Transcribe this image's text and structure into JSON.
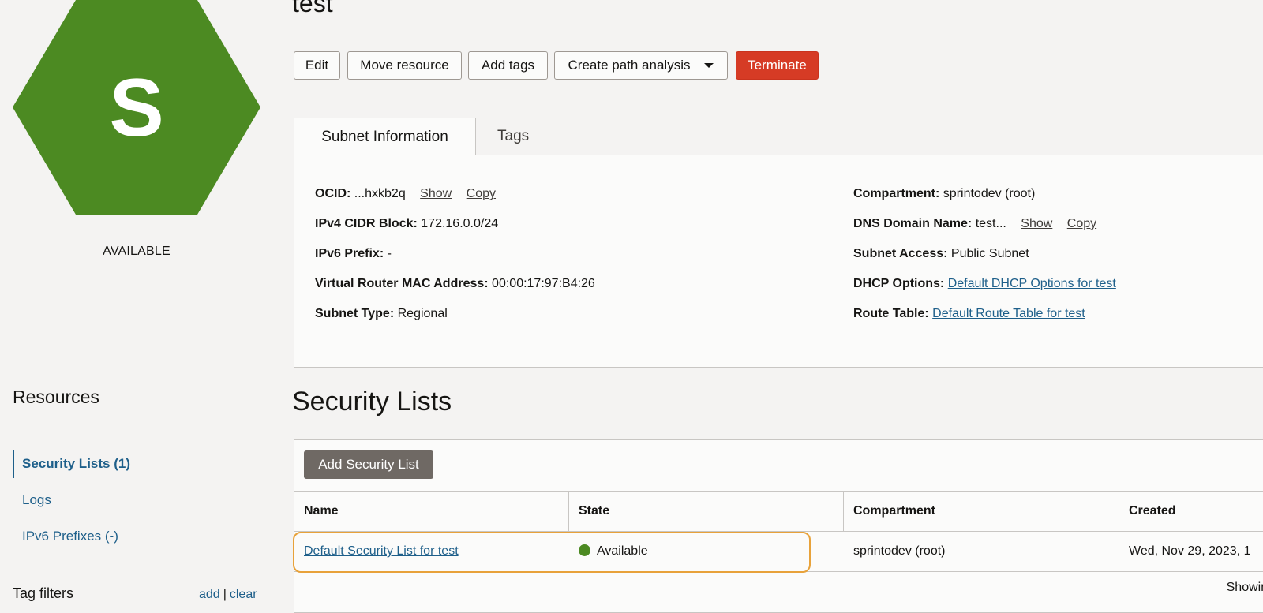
{
  "resource": {
    "icon_letter": "S",
    "state": "AVAILABLE",
    "title": "test",
    "brand_color": "#4c8a22"
  },
  "actions": {
    "edit": "Edit",
    "move": "Move resource",
    "add_tags": "Add tags",
    "path_analysis": "Create path analysis",
    "terminate": "Terminate"
  },
  "tabs": {
    "info": "Subnet Information",
    "tags": "Tags"
  },
  "info": {
    "ocid_label": "OCID:",
    "ocid_value": "...hxkb2q",
    "show": "Show",
    "copy": "Copy",
    "ipv4_label": "IPv4 CIDR Block:",
    "ipv4_value": "172.16.0.0/24",
    "ipv6_label": "IPv6 Prefix:",
    "ipv6_value": "-",
    "mac_label": "Virtual Router MAC Address:",
    "mac_value": "00:00:17:97:B4:26",
    "type_label": "Subnet Type:",
    "type_value": "Regional",
    "compartment_label": "Compartment:",
    "compartment_value": "sprintodev (root)",
    "dns_label": "DNS Domain Name:",
    "dns_value": "test...",
    "access_label": "Subnet Access:",
    "access_value": "Public Subnet",
    "dhcp_label": "DHCP Options:",
    "dhcp_value": "Default DHCP Options for test",
    "route_label": "Route Table:",
    "route_value": "Default Route Table for test"
  },
  "resources": {
    "title": "Resources",
    "items": [
      {
        "label": "Security Lists (1)"
      },
      {
        "label": "Logs"
      },
      {
        "label": "IPv6 Prefixes (-)"
      }
    ],
    "tag_filters": "Tag filters",
    "tag_add": "add",
    "tag_sep": "|",
    "tag_clear": "clear"
  },
  "security_lists": {
    "title": "Security Lists",
    "add_button": "Add Security List",
    "columns": [
      "Name",
      "State",
      "Compartment",
      "Created"
    ],
    "rows": [
      {
        "name": "Default Security List for test",
        "state": "Available",
        "compartment": "sprintodev (root)",
        "created": "Wed, Nov 29, 2023, 1"
      }
    ],
    "footer": "Showing"
  }
}
